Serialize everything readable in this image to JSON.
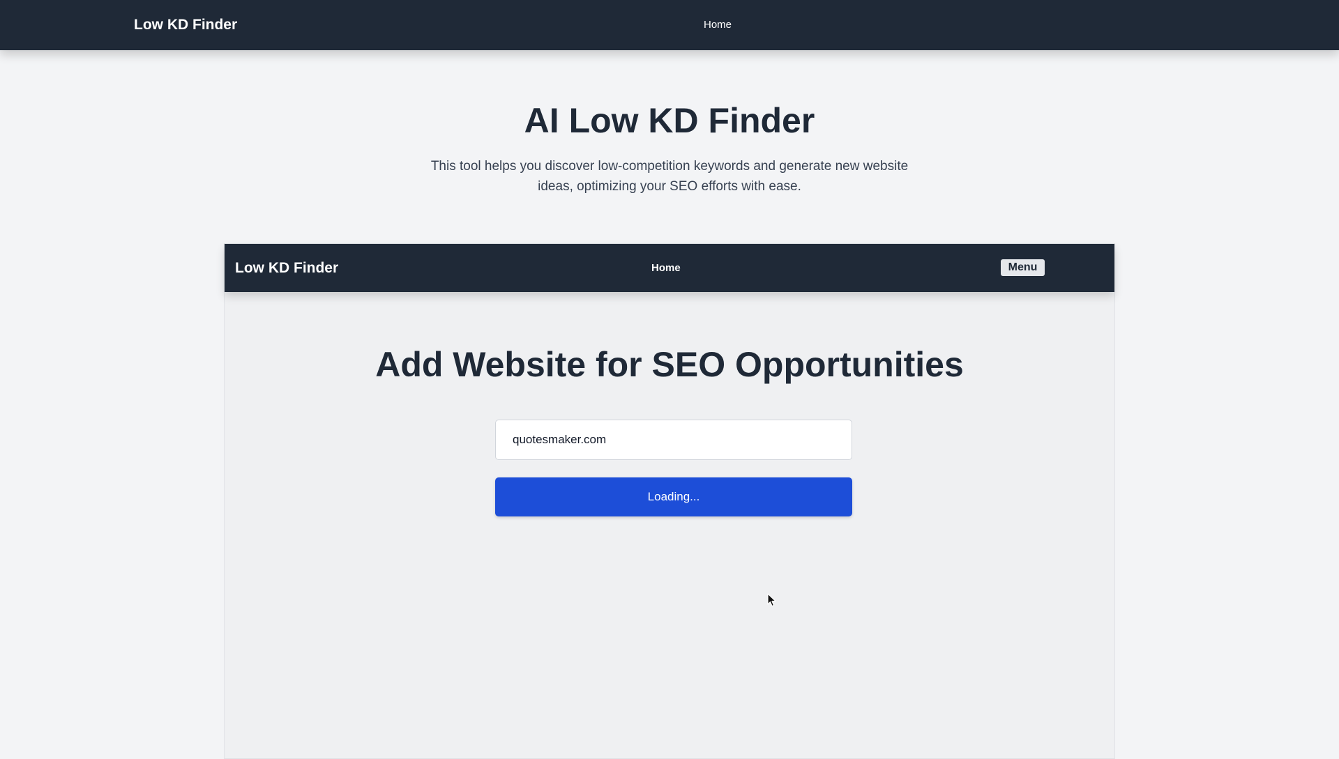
{
  "topbar": {
    "brand": "Low KD Finder",
    "nav_home": "Home"
  },
  "hero": {
    "title": "AI Low KD Finder",
    "description": "This tool helps you discover low-competition keywords and generate new website ideas, optimizing your SEO efforts with ease."
  },
  "embedded_app": {
    "navbar": {
      "brand": "Low KD Finder",
      "nav_home": "Home",
      "menu_label": "Menu"
    },
    "title": "Add Website for SEO Opportunities",
    "website_input": {
      "value": "quotesmaker.com"
    },
    "submit_button": {
      "label": "Loading..."
    }
  },
  "colors": {
    "navbar_bg": "#1f2937",
    "page_bg": "#f3f4f6",
    "primary_button": "#1d4ed8"
  },
  "icons": {
    "cursor": "mouse-pointer-icon"
  }
}
